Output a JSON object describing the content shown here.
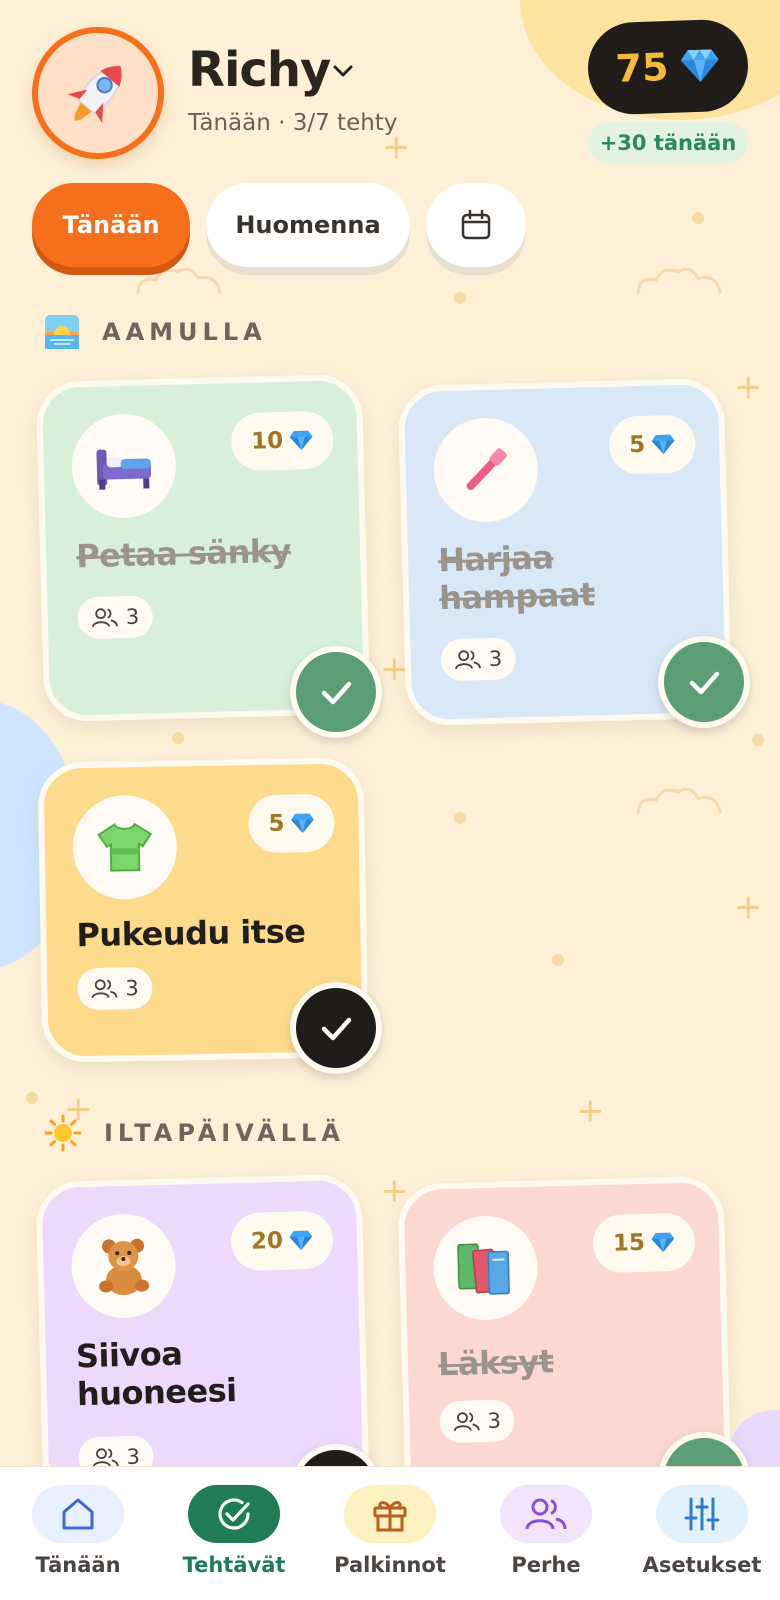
{
  "user": {
    "name": "Richy",
    "subtitle": "Tänään · 3/7 tehty",
    "avatar_icon": "rocket-icon"
  },
  "gems": {
    "total": "75",
    "today": "+30 tänään",
    "icon": "gem-icon"
  },
  "tabs": [
    {
      "label": "Tänään",
      "active": true
    },
    {
      "label": "Huomenna",
      "active": false
    },
    {
      "label": "",
      "icon": "calendar-icon",
      "active": false
    }
  ],
  "sections": [
    {
      "title": "AAMULLA",
      "icon": "sunrise-icon",
      "tasks": [
        {
          "title": "Petaa sänky",
          "reward": "10",
          "people": "3",
          "done": true,
          "icon": "bed-icon",
          "color": "#d8f0d9"
        },
        {
          "title": "Harjaa hampaat",
          "reward": "5",
          "people": "3",
          "done": true,
          "icon": "toothbrush-icon",
          "color": "#d8e8f7"
        },
        {
          "title": "Pukeudu itse",
          "reward": "5",
          "people": "3",
          "done": false,
          "icon": "tshirt-icon",
          "color": "#fcdc8c"
        }
      ]
    },
    {
      "title": "ILTAPÄIVÄLLÄ",
      "icon": "sun-icon",
      "tasks": [
        {
          "title": "Siivoa huoneesi",
          "reward": "20",
          "people": "3",
          "done": false,
          "icon": "teddy-bear-icon",
          "color": "#ecd9fb"
        },
        {
          "title": "Läksyt",
          "reward": "15",
          "people": "3",
          "done": true,
          "icon": "books-icon",
          "color": "#fbd8d2"
        }
      ]
    }
  ],
  "nav": [
    {
      "label": "Tänään",
      "icon": "home-icon",
      "active": false,
      "color": "#e8efff"
    },
    {
      "label": "Tehtävät",
      "icon": "check-circle-icon",
      "active": true,
      "color": "#1f7c57"
    },
    {
      "label": "Palkinnot",
      "icon": "gift-icon",
      "active": false,
      "color": "#fdf1c2"
    },
    {
      "label": "Perhe",
      "icon": "people-icon",
      "active": false,
      "color": "#f1e4fc"
    },
    {
      "label": "Asetukset",
      "icon": "sliders-icon",
      "active": false,
      "color": "#e3f1fd"
    }
  ],
  "colors": {
    "accent": "#f66f1d",
    "done_check": "#5b9e76",
    "background": "#fdf0d7"
  }
}
